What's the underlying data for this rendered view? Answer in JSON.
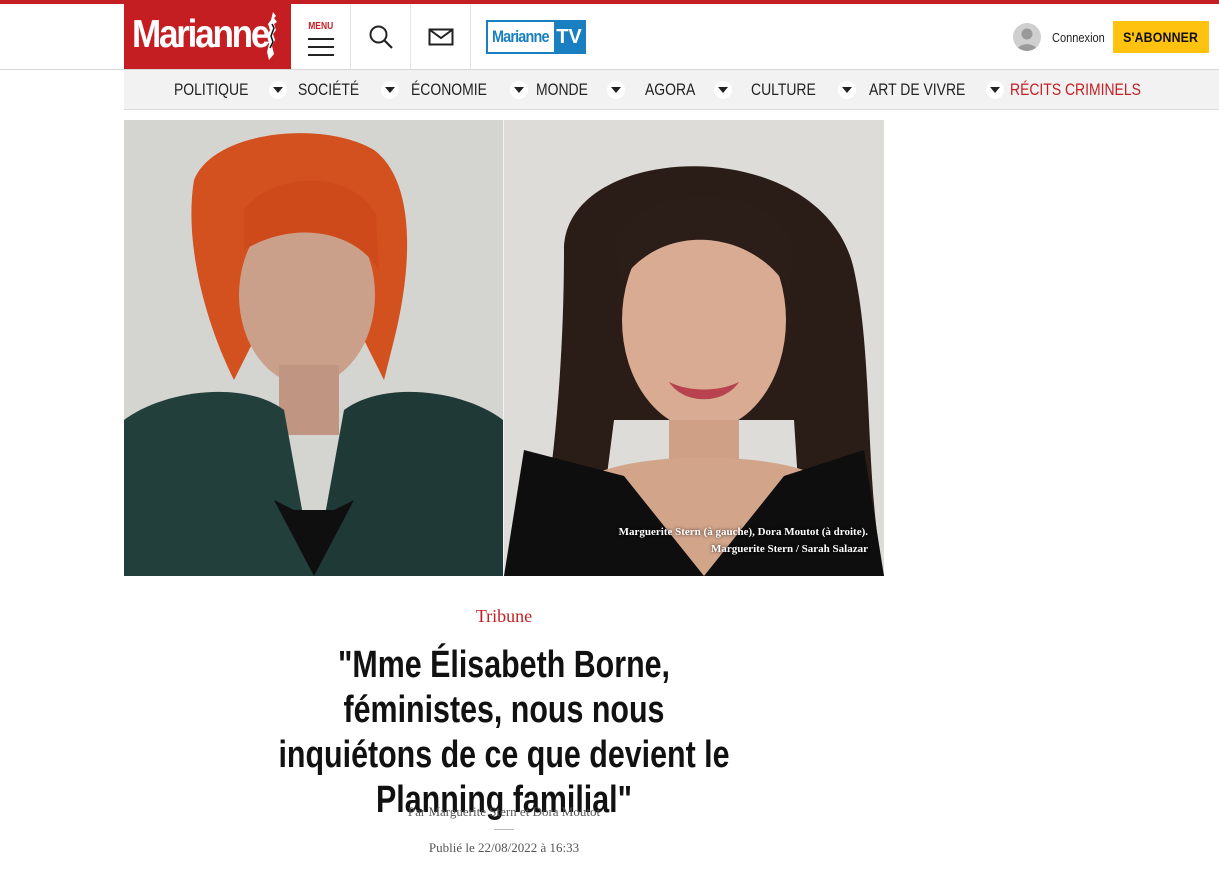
{
  "header": {
    "logo_text": "Marianne",
    "menu_label": "MENU",
    "tv_logo_main": "Marianne",
    "tv_logo_suffix": "TV",
    "login_label": "Connexion",
    "subscribe_label": "S'ABONNER",
    "icons": [
      "hamburger-icon",
      "search-icon",
      "mail-icon",
      "user-avatar-icon"
    ]
  },
  "nav": {
    "items": [
      {
        "label": "Politique"
      },
      {
        "label": "Société"
      },
      {
        "label": "Économie"
      },
      {
        "label": "Monde"
      },
      {
        "label": "Agora"
      },
      {
        "label": "Culture"
      },
      {
        "label": "Art de vivre"
      },
      {
        "label": "Récits criminels"
      }
    ]
  },
  "photo": {
    "caption_line1": "Marguerite Stern (à gauche), Dora Moutot (à droite).",
    "caption_line2": "Marguerite Stern / Sarah Salazar"
  },
  "article": {
    "kicker": "Tribune",
    "title": "\"Mme Élisabeth Borne, féministes, nous nous inquiétons de ce que devient le Planning familial\"",
    "byline": "Par Marguerite Stern et Dora Moutot",
    "published": "Publié le 22/08/2022 à 16:33"
  },
  "colors": {
    "brand_red": "#c41e23",
    "subscribe_yellow": "#ffc20e",
    "tv_blue": "#1a7fc1"
  }
}
